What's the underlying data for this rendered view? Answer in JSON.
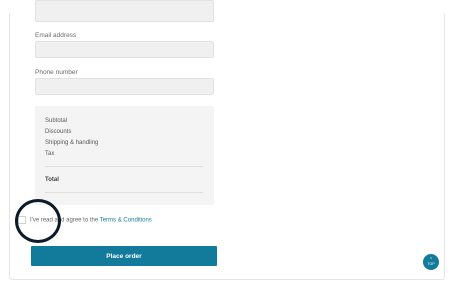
{
  "form": {
    "email_label": "Email address",
    "phone_label": "Phone number"
  },
  "summary": {
    "subtotal_label": "Subtotal",
    "discounts_label": "Discounts",
    "shipping_label": "Shipping & handling",
    "tax_label": "Tax",
    "total_label": "Total"
  },
  "terms": {
    "prefix": "I've read and agree to the ",
    "link": "Terms & Conditions",
    "checked": false
  },
  "actions": {
    "place_order": "Place order",
    "top_label": "TOP"
  },
  "colors": {
    "accent": "#127a9b",
    "highlight_ring": "#0d1a2a"
  },
  "icons": {
    "top": "chevron-up-icon"
  }
}
